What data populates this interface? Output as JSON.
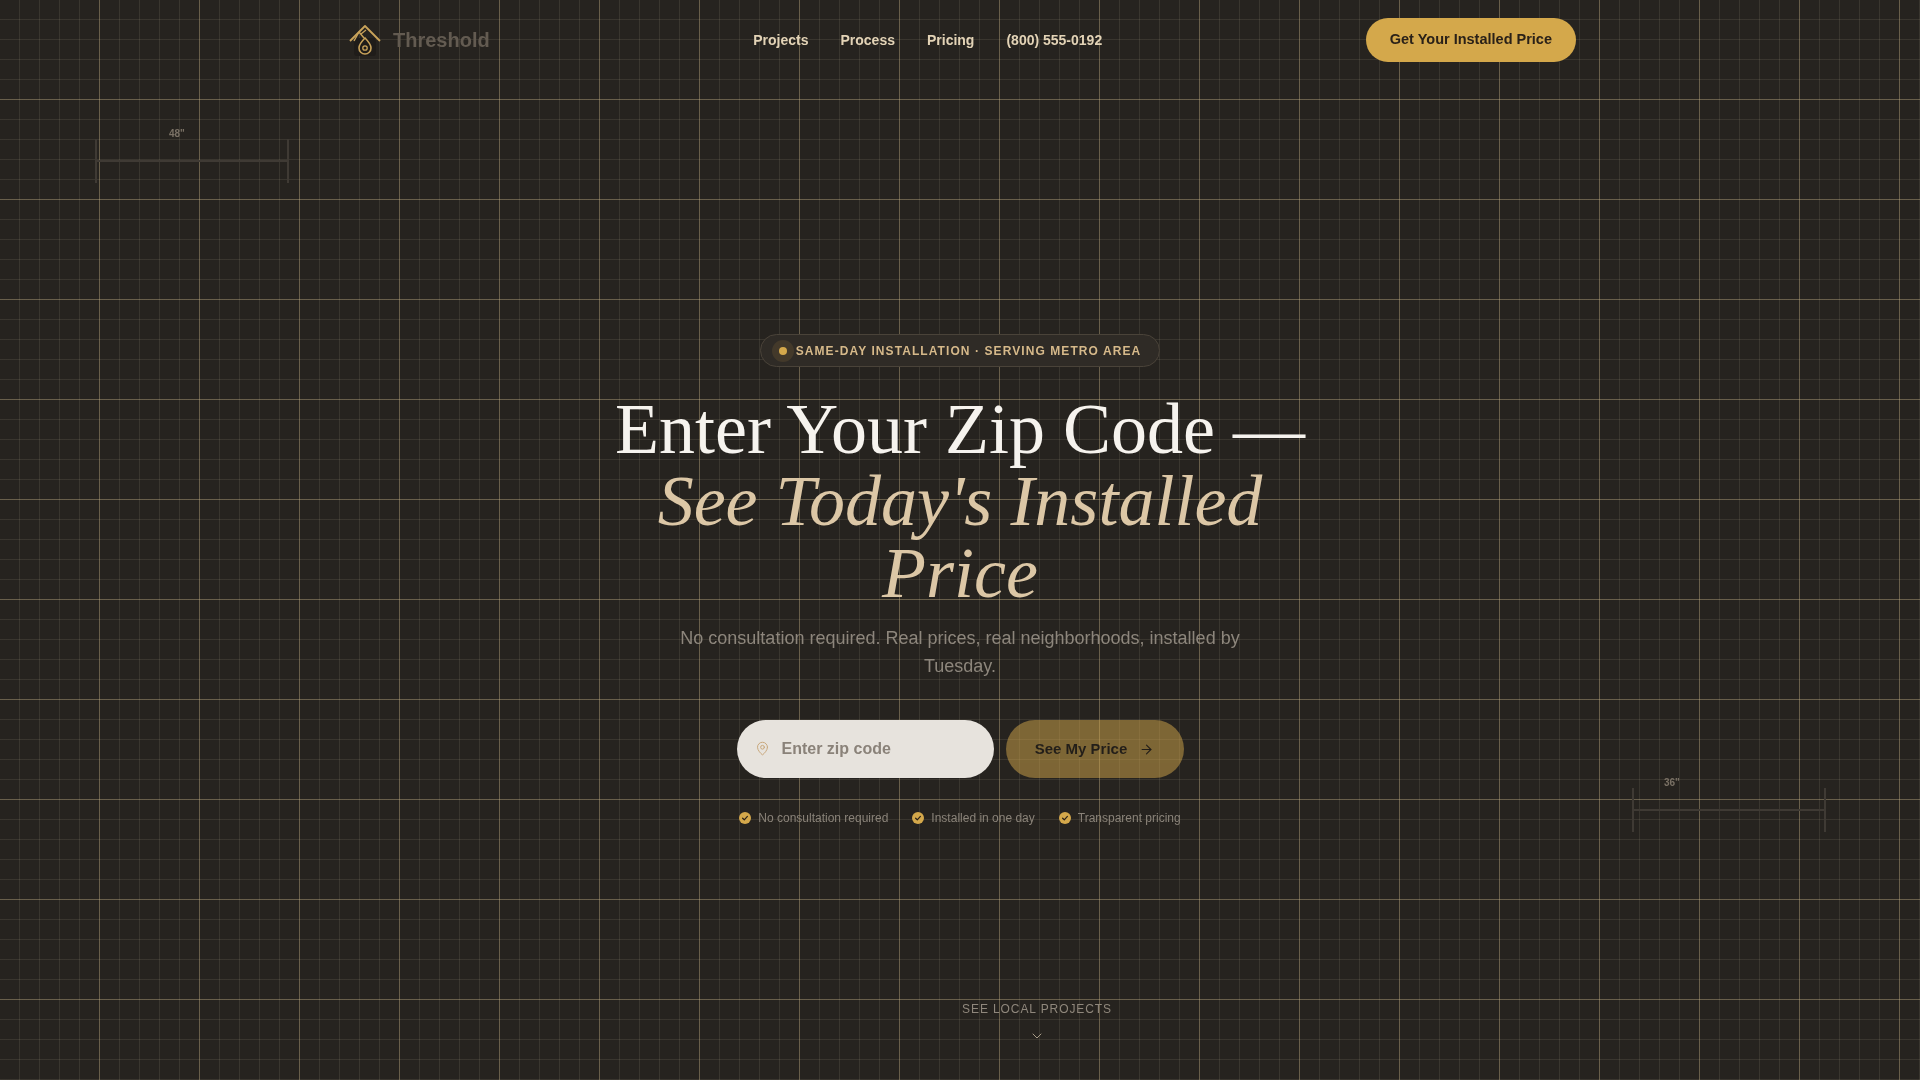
{
  "header": {
    "logo": "Threshold",
    "nav": [
      "Projects",
      "Process",
      "Pricing"
    ],
    "phone": "(800) 555-0192",
    "cta": "Get Your Installed Price"
  },
  "dimension_marks": [
    {
      "label": "48\""
    },
    {
      "label": "36\""
    }
  ],
  "hero": {
    "badge": "SAME-DAY INSTALLATION · SERVING METRO AREA",
    "title": "Enter Your Zip Code —",
    "title_accent": "See Today's Installed Price",
    "subtitle": "No consultation required. Real prices, real neighborhoods, installed by Tuesday.",
    "zip_form": {
      "placeholder": "Enter zip code",
      "button": {
        "label": "See My Price",
        "disabled": true
      }
    },
    "benefits": [
      "No consultation required",
      "Installed in one day",
      "Transparent pricing"
    ]
  },
  "scroll_hint": "SEE LOCAL PROJECTS"
}
